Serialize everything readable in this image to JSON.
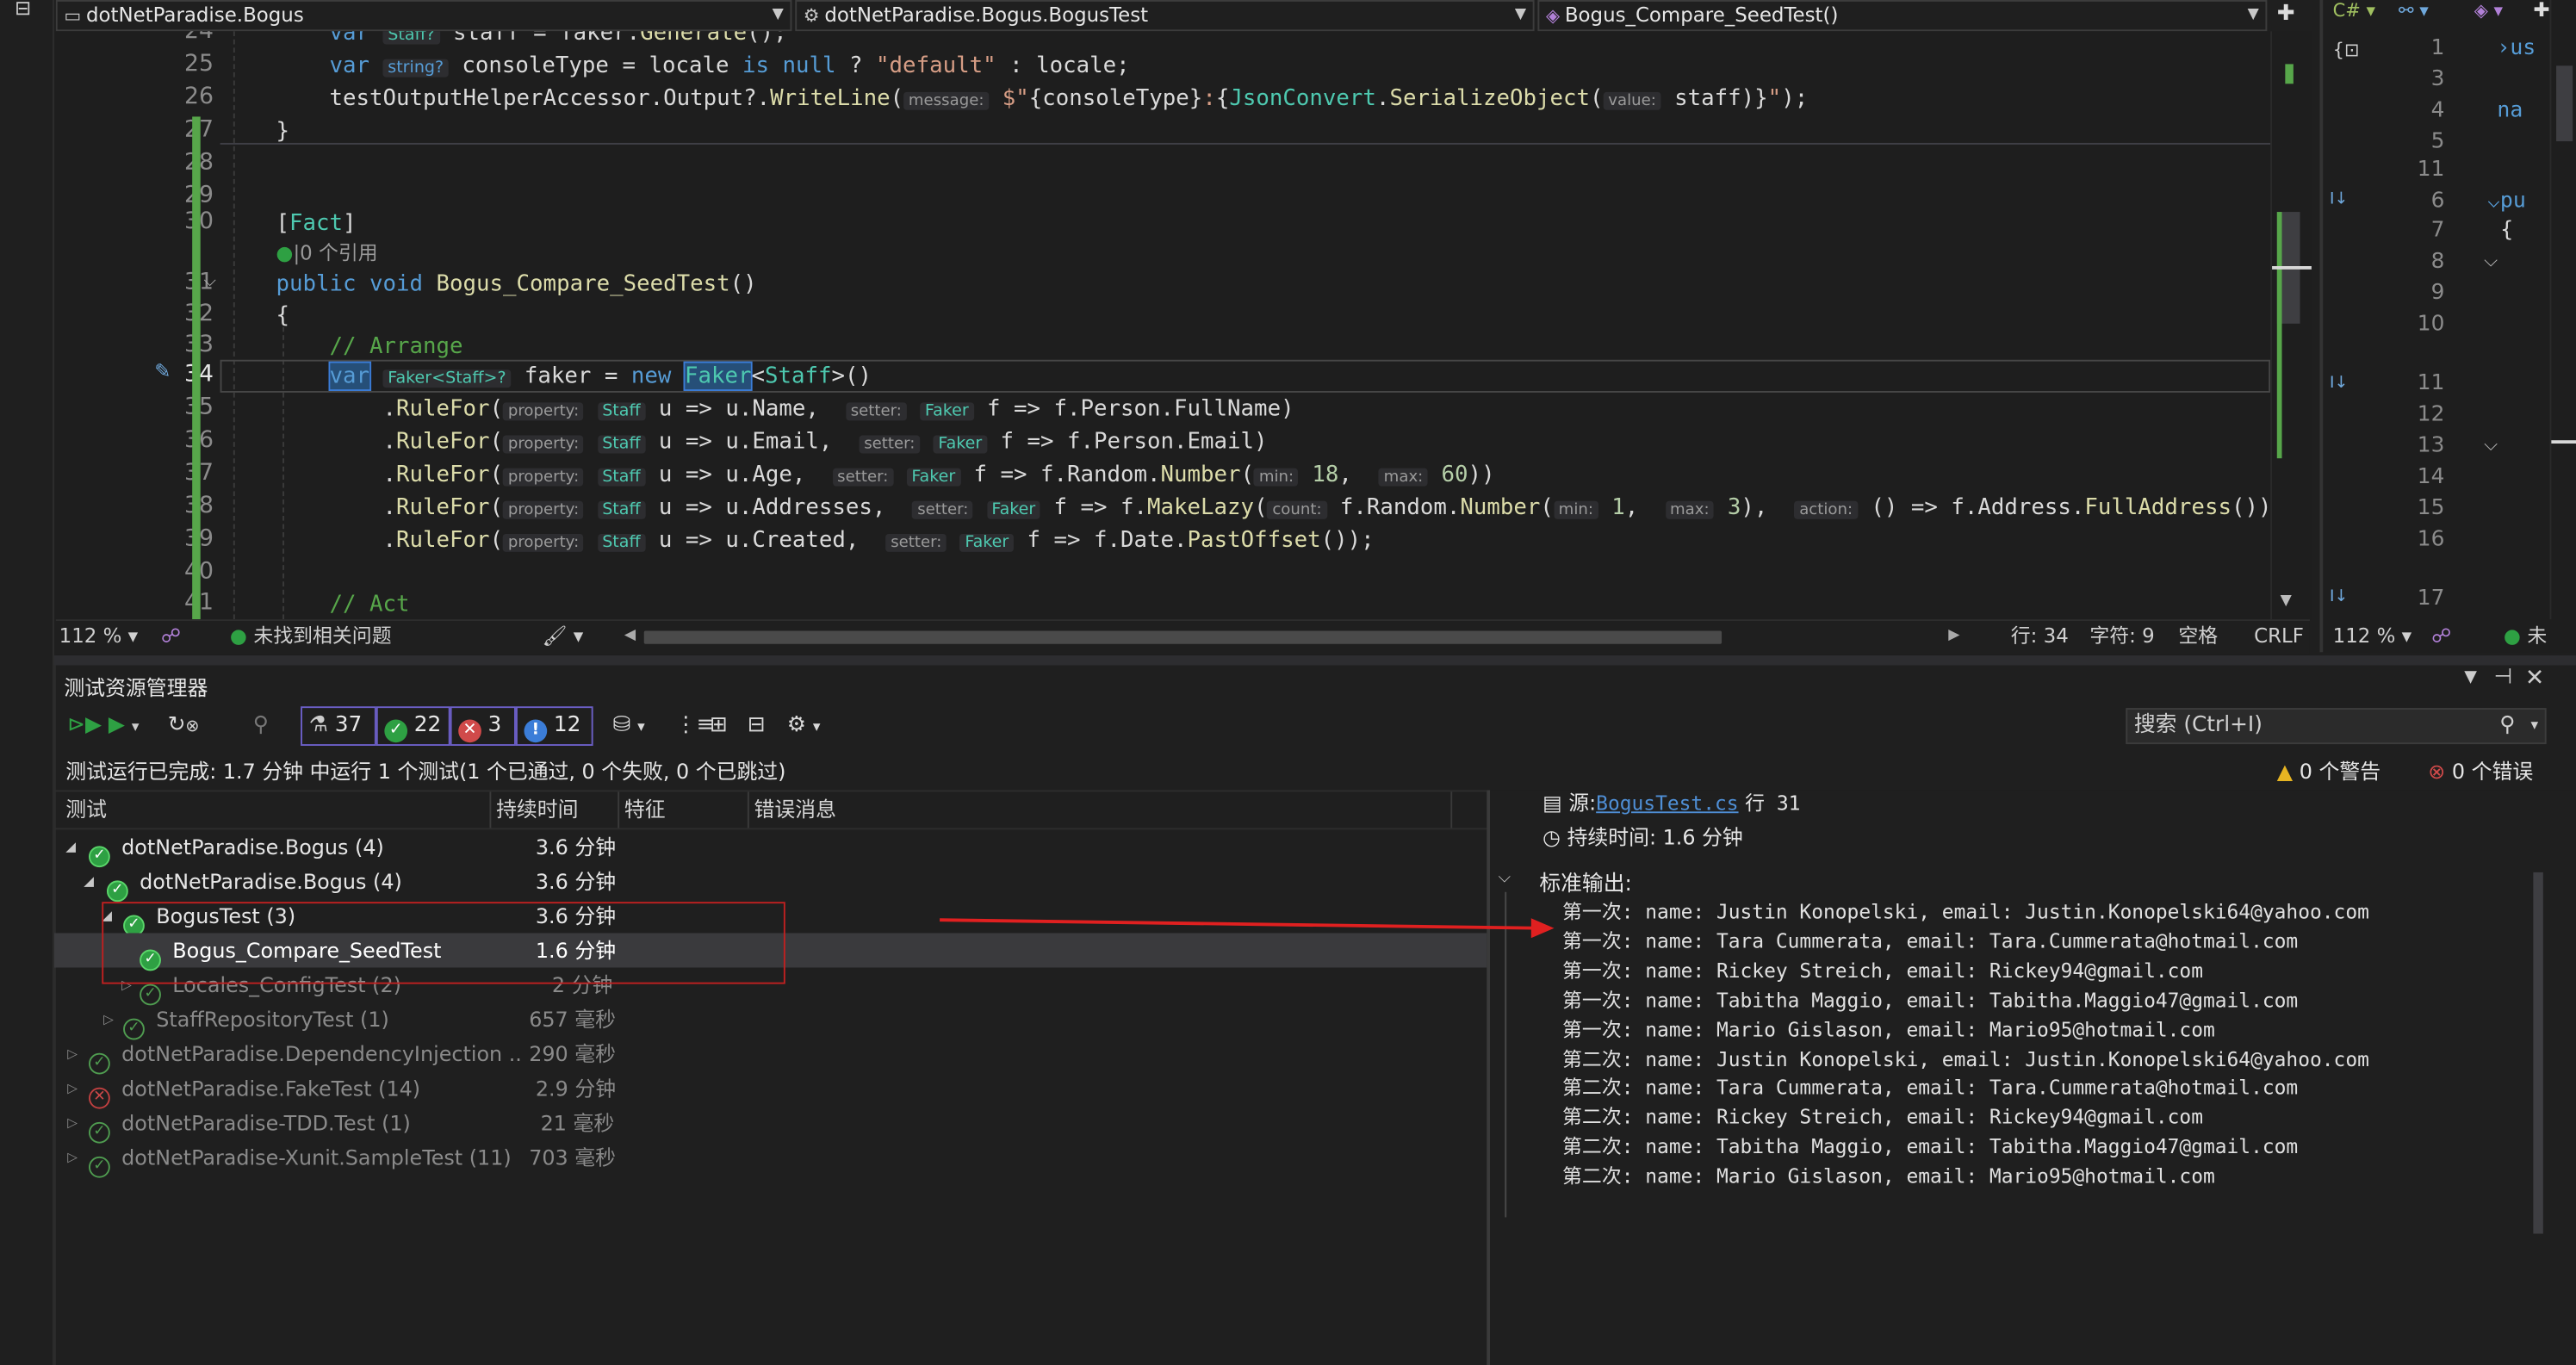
{
  "nav": {
    "project": "dotNetParadise.Bogus",
    "class": "dotNetParadise.Bogus.BogusTest",
    "member": "Bogus_Compare_SeedTest()"
  },
  "editor": {
    "line_numbers": [
      "24",
      "25",
      "26",
      "27",
      "28",
      "29",
      "30",
      "",
      "31",
      "32",
      "33",
      "34",
      "35",
      "36",
      "37",
      "38",
      "39",
      "40",
      "41"
    ],
    "codelens": "0 个引用",
    "zoom": "112 %",
    "issues": "未找到相关问题",
    "pos_line": "行: 34",
    "pos_char": "字符: 9",
    "indent": "空格",
    "eol": "CRLF"
  },
  "right_editor": {
    "line_numbers": [
      "1",
      "3",
      "4",
      "5",
      "11",
      "6",
      "7",
      "8",
      "9",
      "10",
      "11",
      "12",
      "13",
      "14",
      "15",
      "16",
      "17"
    ],
    "zoom": "112 %",
    "issues": "未"
  },
  "test_explorer": {
    "title": "测试资源管理器",
    "counts": {
      "total": "37",
      "passed": "22",
      "failed": "3",
      "not_run": "12"
    },
    "search_placeholder": "搜索 (Ctrl+I)",
    "summary": "测试运行已完成: 1.7 分钟 中运行 1 个测试(1 个已通过, 0 个失败, 0 个已跳过)",
    "warnings": "0 个警告",
    "errors": "0 个错误",
    "columns": [
      "测试",
      "持续时间",
      "特征",
      "错误消息"
    ],
    "rows": [
      {
        "name": "dotNetParadise.Bogus (4)",
        "duration": "3.6 分钟"
      },
      {
        "name": "dotNetParadise.Bogus (4)",
        "duration": "3.6 分钟"
      },
      {
        "name": "BogusTest (3)",
        "duration": "3.6 分钟"
      },
      {
        "name": "Bogus_Compare_SeedTest",
        "duration": "1.6 分钟"
      },
      {
        "name": "Locales_ConfigTest (2)",
        "duration": "2 分钟"
      },
      {
        "name": "StaffRepositoryTest (1)",
        "duration": "657 毫秒"
      },
      {
        "name": "dotNetParadise.DependencyInjection ..",
        "duration": "290 毫秒"
      },
      {
        "name": "dotNetParadise.FakeTest (14)",
        "duration": "2.9 分钟"
      },
      {
        "name": "dotNetParadise-TDD.Test (1)",
        "duration": "21 毫秒"
      },
      {
        "name": "dotNetParadise-Xunit.SampleTest (11)",
        "duration": "703 毫秒"
      }
    ]
  },
  "details": {
    "source_label": "源:",
    "source_file": "BogusTest.cs",
    "source_line": "行 31",
    "duration": "持续时间: 1.6 分钟",
    "stdout_title": "标准输出:",
    "output": [
      "第一次: name: Justin Konopelski, email: Justin.Konopelski64@yahoo.com",
      "第一次: name: Tara Cummerata, email: Tara.Cummerata@hotmail.com",
      "第一次: name: Rickey Streich, email: Rickey94@gmail.com",
      "第一次: name: Tabitha Maggio, email: Tabitha.Maggio47@gmail.com",
      "第一次: name: Mario Gislason, email: Mario95@hotmail.com",
      "第二次: name: Justin Konopelski, email: Justin.Konopelski64@yahoo.com",
      "第二次: name: Tara Cummerata, email: Tara.Cummerata@hotmail.com",
      "第二次: name: Rickey Streich, email: Rickey94@gmail.com",
      "第二次: name: Tabitha Maggio, email: Tabitha.Maggio47@gmail.com",
      "第二次: name: Mario Gislason, email: Mario95@hotmail.com"
    ]
  },
  "colors": {
    "accent": "#569cd6",
    "pass": "#2ea043",
    "fail": "#d04a4a",
    "annotation": "#e02020"
  }
}
